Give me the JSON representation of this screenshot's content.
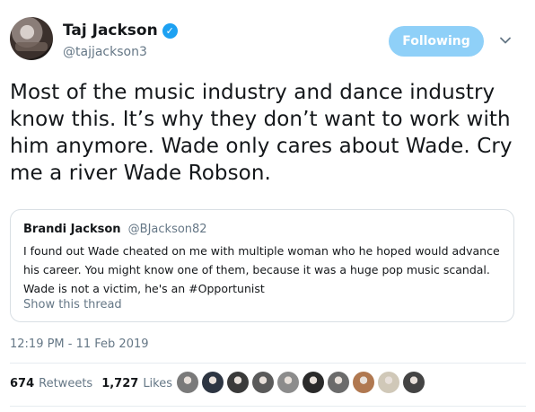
{
  "author": {
    "name": "Taj Jackson",
    "handle": "@tajjackson3",
    "verified_icon": "verified-check-icon"
  },
  "follow_button": {
    "label": "Following",
    "color": "#8fd0f8"
  },
  "tweet_text": "Most of the music industry and dance industry know this. It’s why they don’t want to work with him anymore. Wade only cares about Wade. Cry me a river Wade Robson.",
  "quoted": {
    "name": "Brandi Jackson",
    "handle": "@BJackson82",
    "text": "I found out Wade cheated on me with multiple woman who he hoped would advance his career.  You might know one of them, because it was a huge pop music scandal. Wade is not a victim, he's an #Opportunist",
    "show_thread": "Show this thread"
  },
  "timestamp": "12:19 PM - 11 Feb 2019",
  "stats": {
    "retweets_count": "674",
    "retweets_label": "Retweets",
    "likes_count": "1,727",
    "likes_label": "Likes"
  },
  "likers": [
    {
      "color": "#7a7a7a"
    },
    {
      "color": "#2d3542"
    },
    {
      "color": "#3a3a3a"
    },
    {
      "color": "#5a5a5a"
    },
    {
      "color": "#8c8c8c"
    },
    {
      "color": "#2a2a2a"
    },
    {
      "color": "#6b6b6b"
    },
    {
      "color": "#b07850"
    },
    {
      "color": "#d0c8b8"
    },
    {
      "color": "#444444"
    }
  ]
}
